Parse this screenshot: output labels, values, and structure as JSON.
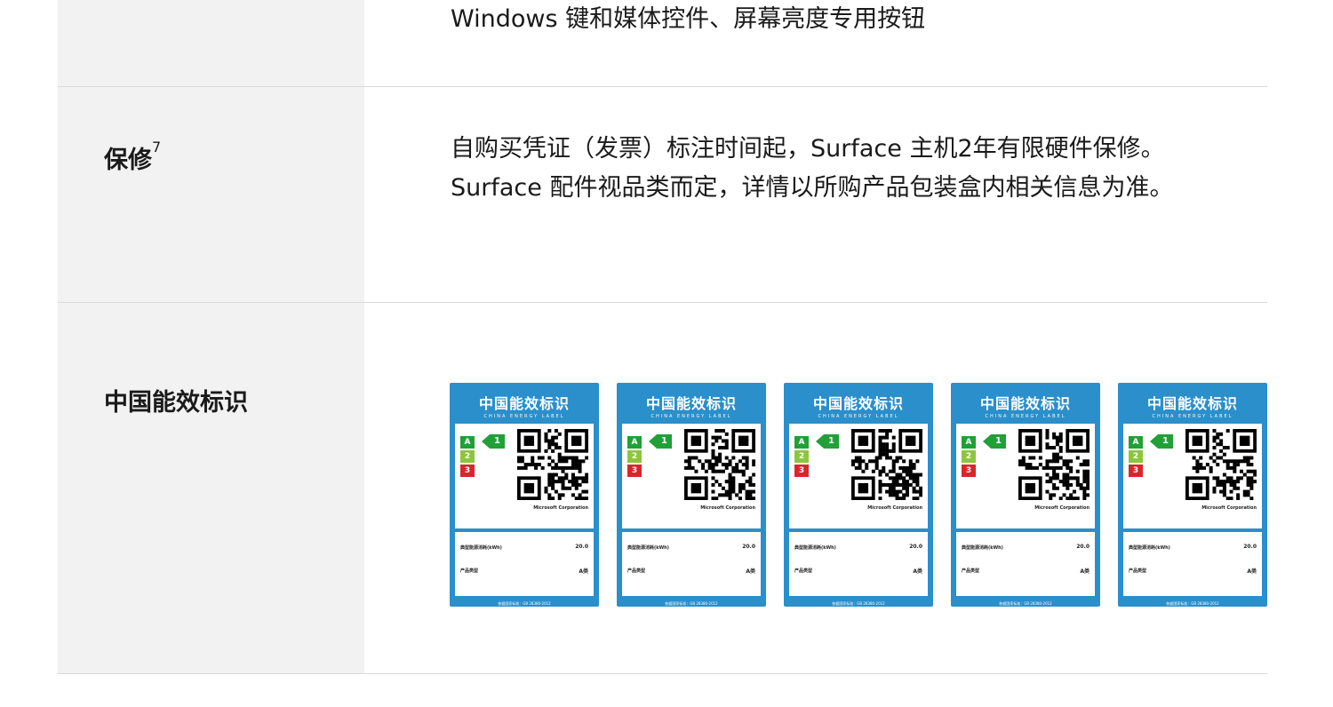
{
  "rows": [
    {
      "label": "",
      "value": "Windows 键和媒体控件、屏幕亮度专用按钮"
    },
    {
      "label": "保修",
      "sup": "7",
      "value": "自购买凭证（发票）标注时间起，Surface 主机2年有限硬件保修。Surface 配件视品类而定，详情以所购产品包装盒内相关信息为准。"
    },
    {
      "label": "中国能效标识"
    }
  ],
  "energy_labels": [
    {
      "title": "中国能效标识",
      "subtitle": "CHINA ENERGY LABEL",
      "grade": "1",
      "company": "Microsoft Corporation",
      "energy_label": "典型能源消耗(kWh)",
      "energy_value": "20.0",
      "class_label": "产品类型",
      "class_value": "A类",
      "footer": "依据国家标准：GB 28380-2012"
    },
    {
      "title": "中国能效标识",
      "subtitle": "CHINA ENERGY LABEL",
      "grade": "1",
      "company": "Microsoft Corporation",
      "energy_label": "典型能源消耗(kWh)",
      "energy_value": "20.0",
      "class_label": "产品类型",
      "class_value": "A类",
      "footer": "依据国家标准：GB 28380-2012"
    },
    {
      "title": "中国能效标识",
      "subtitle": "CHINA ENERGY LABEL",
      "grade": "1",
      "company": "Microsoft Corporation",
      "energy_label": "典型能源消耗(kWh)",
      "energy_value": "20.0",
      "class_label": "产品类型",
      "class_value": "A类",
      "footer": "依据国家标准：GB 28380-2012"
    },
    {
      "title": "中国能效标识",
      "subtitle": "CHINA ENERGY LABEL",
      "grade": "1",
      "company": "Microsoft Corporation",
      "energy_label": "典型能源消耗(kWh)",
      "energy_value": "20.0",
      "class_label": "产品类型",
      "class_value": "A类",
      "footer": "依据国家标准：GB 28380-2012"
    },
    {
      "title": "中国能效标识",
      "subtitle": "CHINA ENERGY LABEL",
      "grade": "1",
      "company": "Microsoft Corporation",
      "energy_label": "典型能源消耗(kWh)",
      "energy_value": "20.0",
      "class_label": "产品类型",
      "class_value": "A类",
      "footer": "依据国家标准：GB 28380-2012"
    }
  ],
  "colors": {
    "label_blue": "#2a8fcb",
    "grade1": "#21a038",
    "grade2": "#8cc63e",
    "grade3": "#d8262c"
  }
}
